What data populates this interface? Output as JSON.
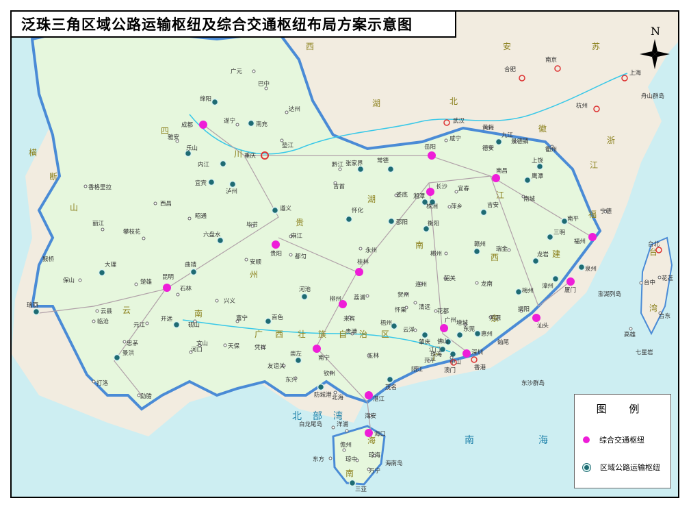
{
  "title": "泛珠三角区域公路运输枢纽及综合交通枢纽布局方案示意图",
  "compass": "N",
  "legend": {
    "title": "图 例",
    "items": [
      {
        "label": "综合交通枢纽",
        "color": "#ee1dd8"
      },
      {
        "label": "区域公路运输枢纽",
        "color": "#1e6b73"
      }
    ]
  },
  "colors": {
    "land": "#e6f7dd",
    "outside": "#f2ece0",
    "sea": "#cdeef2",
    "road": "#b0a0a8"
  },
  "province_labels": [
    "西",
    "安",
    "苏",
    "湖",
    "北",
    "四",
    "川",
    "徽",
    "浙",
    "江",
    "湖",
    "贵",
    "南",
    "江",
    "福",
    "州",
    "西",
    "建",
    "云",
    "南",
    "广",
    "西",
    "壮",
    "族",
    "自",
    "治",
    "区",
    "广",
    "东",
    "台",
    "湾",
    "海",
    "南",
    "横",
    "断",
    "山"
  ],
  "sea_labels": [
    "北",
    "部",
    "湾",
    "南",
    "海",
    "东沙群岛"
  ],
  "comprehensive_hubs": [
    "成都",
    "重庆",
    "岳阳",
    "长沙",
    "南昌",
    "贵阳",
    "福州",
    "昆明",
    "桂林",
    "柳州",
    "厦门",
    "广州",
    "汕头",
    "深圳",
    "南宁",
    "湛江",
    "海口"
  ],
  "regional_hubs": [
    "绵阳",
    "南充",
    "乐山",
    "内江",
    "泸州",
    "宜宾",
    "遵义",
    "六盘水",
    "曲靖",
    "大理",
    "瑞丽",
    "景洪",
    "开远",
    "张家界",
    "常德",
    "怀化",
    "邵阳",
    "衡阳",
    "湘潭",
    "株洲",
    "九江",
    "上饶",
    "鹰潭",
    "吉安",
    "赣州",
    "南平",
    "三明",
    "龙岩",
    "漳州",
    "泉州",
    "梅州",
    "河池",
    "百色",
    "崇左",
    "梧州",
    "佛山",
    "东莞",
    "中山",
    "江门",
    "肇庆",
    "惠州",
    "茂名",
    "防城港",
    "三亚"
  ],
  "reference_cities": [
    "上海",
    "南京",
    "合肥",
    "武汉",
    "杭州",
    "台北",
    "香港",
    "澳门"
  ],
  "other_places": [
    "广元",
    "巴中",
    "达州",
    "遂宁",
    "雅安",
    "垫江",
    "西昌",
    "香格里拉",
    "丽江",
    "攀枝花",
    "昭通",
    "毕节",
    "麻江",
    "安顺",
    "都匀",
    "保山",
    "楚雄",
    "石林",
    "兴义",
    "云县",
    "临沧",
    "元江",
    "砚山",
    "思茅",
    "河口",
    "文山",
    "富宁",
    "天保",
    "友谊关",
    "凭祥",
    "东兴",
    "钦州",
    "北海",
    "玉林",
    "贵港",
    "来宾",
    "荔浦",
    "贺州",
    "怀集",
    "连州",
    "清远",
    "韶关",
    "花都",
    "增城",
    "河源",
    "揭阳",
    "汕尾",
    "龙南",
    "瑞金",
    "郴州",
    "永州",
    "娄底",
    "吉首",
    "黔江",
    "宜春",
    "萍乡",
    "咸宁",
    "黄梅",
    "景德镇",
    "衢州",
    "德安",
    "南城",
    "宁德",
    "云浮",
    "阳江",
    "开平",
    "珠海",
    "白龙尾岛",
    "洋浦",
    "儋州",
    "琼中",
    "琼海",
    "海南岛",
    "万宁",
    "东方",
    "舟山群岛",
    "澎湖列岛",
    "花莲",
    "台中",
    "台东",
    "高雄",
    "七星岩",
    "勐腊",
    "打洛",
    "猴桥",
    "海安"
  ]
}
